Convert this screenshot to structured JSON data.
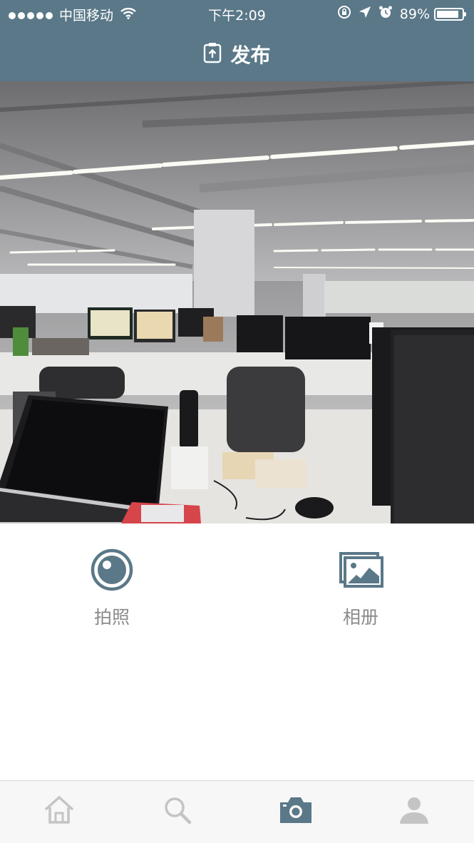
{
  "status_bar": {
    "carrier": "中国移动",
    "time": "下午2:09",
    "battery_percent_text": "89%",
    "battery_level": 0.89
  },
  "nav": {
    "title": "发布",
    "title_icon": "upload-doc-icon"
  },
  "actions": [
    {
      "label": "拍照",
      "icon": "camera-lens-icon"
    },
    {
      "label": "相册",
      "icon": "gallery-icon"
    }
  ],
  "tabbar": {
    "items": [
      {
        "name": "home",
        "icon": "home-icon",
        "active": false
      },
      {
        "name": "search",
        "icon": "search-icon",
        "active": false
      },
      {
        "name": "camera",
        "icon": "camera-icon",
        "active": true
      },
      {
        "name": "profile",
        "icon": "profile-icon",
        "active": false
      }
    ]
  },
  "colors": {
    "header": "#5a7888",
    "accent": "#5a7888",
    "inactive": "#c4c4c4",
    "label": "#8a8a8a"
  }
}
